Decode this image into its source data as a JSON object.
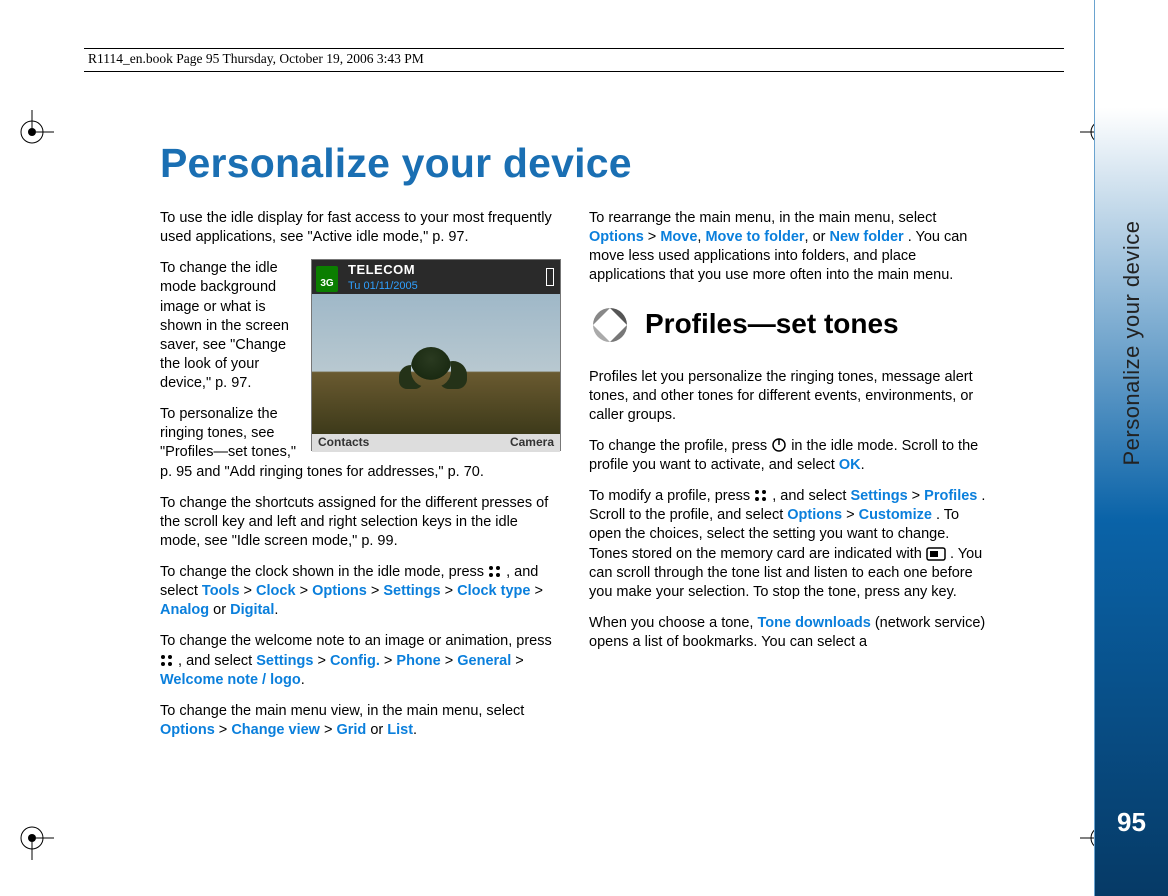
{
  "header": {
    "running": "R1114_en.book  Page 95  Thursday, October 19, 2006  3:43 PM"
  },
  "title": "Personalize your device",
  "sidebar": {
    "label": "Personalize your device",
    "page_number": "95"
  },
  "phone": {
    "net_tag": "3G",
    "operator": "TELECOM",
    "date": "Tu 01/11/2005",
    "softkey_left": "Contacts",
    "softkey_right": "Camera"
  },
  "left": {
    "p1": "To use the idle display for fast access to your most frequently used applications, see \"Active idle mode,\" p. 97.",
    "p2": "To change the idle mode background image or what is shown in the screen saver, see \"Change the look of your device,\" p. 97.",
    "p3": "To personalize the ringing tones, see \"Profiles—set tones,\" p. 95 and \"Add ringing tones for addresses,\" p. 70.",
    "p4": "To change the shortcuts assigned for the different presses of the scroll key and left and right selection keys in the idle mode, see \"Idle screen mode,\" p. 99.",
    "p5_a": "To change the clock shown in the idle mode, press ",
    "p5_b": " , and select ",
    "tools": "Tools",
    "gt1": " > ",
    "clock": "Clock",
    "gt2": " > ",
    "options": "Options",
    "gt3": " > ",
    "settings": "Settings",
    "gt4": " > ",
    "clocktype": "Clock type",
    "gt5": " > ",
    "analog": "Analog",
    "or1": " or ",
    "digital": "Digital",
    "dot1": ".",
    "p6_a": "To change the welcome note to an image or animation, press ",
    "p6_b": " , and select ",
    "settings2": "Settings",
    "gt6": " > ",
    "config": "Config.",
    "gt7": " > ",
    "phone": "Phone",
    "gt8": " > ",
    "general": "General",
    "gt9": " > ",
    "welcome": "Welcome note / logo",
    "dot2": ".",
    "p7_a": "To change the main menu view, in the main menu, select ",
    "options2": "Options",
    "gt10": " > ",
    "changeview": "Change view",
    "gt11": " > ",
    "grid": "Grid",
    "or2": " or ",
    "list": "List",
    "dot3": "."
  },
  "right": {
    "p1_a": "To rearrange the main menu, in the main menu, select ",
    "options": "Options",
    "gt1": " > ",
    "move": "Move",
    "c1": ", ",
    "movetf": "Move to folder",
    "c2": ", or ",
    "newf": "New folder",
    "p1_b": ". You can move less used applications into folders, and place applications that you use more often into the main menu.",
    "h2": "Profiles—set tones",
    "p2": "Profiles let you personalize the ringing tones, message alert tones, and other tones for different events, environments, or caller groups.",
    "p3_a": "To change the profile, press ",
    "p3_b": " in the idle mode. Scroll to the profile you want to activate, and select ",
    "ok": "OK",
    "dot1": ".",
    "p4_a": "To modify a profile, press ",
    "p4_b": " , and select ",
    "settings": "Settings",
    "gt2": " > ",
    "profiles": "Profiles",
    "p4_c": ". Scroll to the profile, and select ",
    "options2": "Options",
    "gt3": " > ",
    "customize": "Customize",
    "p4_d": ". To open the choices, select the setting you want to change. Tones stored on the memory card are indicated with ",
    "p4_e": ". You can scroll through the tone list and listen to each one before you make your selection. To stop the tone, press any key.",
    "p5_a": "When you choose a tone, ",
    "tonedl": "Tone downloads",
    "p5_b": " (network service) opens a list of bookmarks. You can select a"
  }
}
